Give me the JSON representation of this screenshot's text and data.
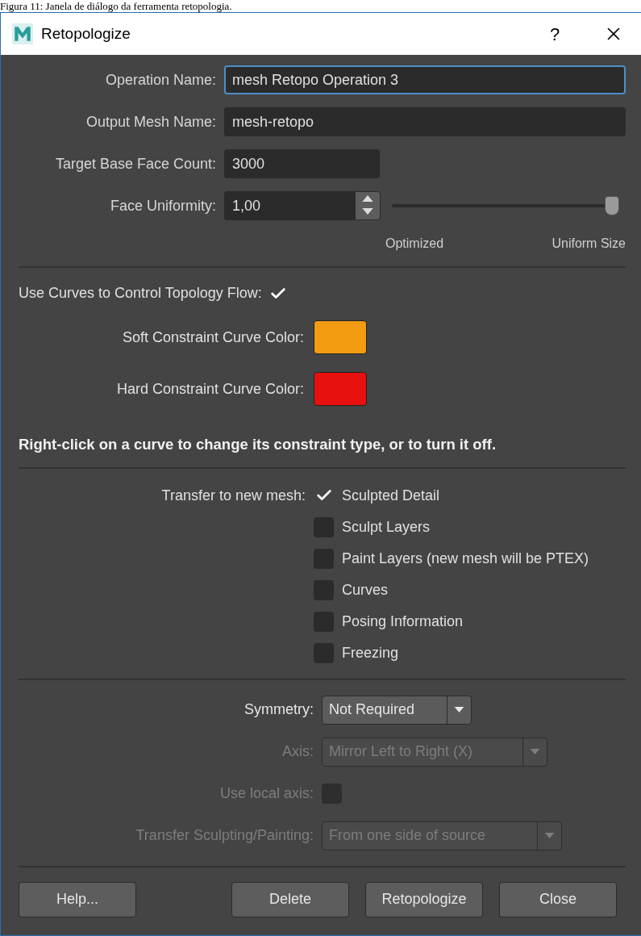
{
  "caption": "Figura 11: Janela de diálogo da ferramenta retopologia.",
  "window": {
    "title": "Retopologize",
    "help": "?"
  },
  "fields": [
    {
      "kind": "text",
      "label": "Operation Name:",
      "value": "mesh Retopo Operation 3",
      "focused": true
    },
    {
      "kind": "text",
      "label": "Output Mesh Name:",
      "value": "mesh-retopo",
      "focused": false
    },
    {
      "kind": "short",
      "label": "Target Base Face Count:",
      "value": "3000",
      "focused": false
    },
    {
      "kind": "spinner",
      "label": "Face Uniformity:",
      "value": "1,00",
      "focused": false,
      "level": 1.0,
      "min_label": "Optimized",
      "max_label": "Uniform Size"
    }
  ],
  "curves": {
    "label": "Use Curves to Control Topology Flow:",
    "checked": true
  },
  "curve_colors": [
    {
      "label": "Soft Constraint Curve Color:",
      "color": "#f39c12"
    },
    {
      "label": "Hard Constraint Curve Color:",
      "color": "#e8100f"
    }
  ],
  "note": "Right-click on a curve to change its constraint type, or to turn it off.",
  "transfer": {
    "label": "Transfer to new mesh:",
    "options": [
      {
        "label": "Sculpted Detail",
        "checked": true
      },
      {
        "label": "Sculpt Layers",
        "checked": false
      },
      {
        "label": "Paint Layers (new mesh will be PTEX)",
        "checked": false
      },
      {
        "label": "Curves",
        "checked": false
      },
      {
        "label": "Posing Information",
        "checked": false
      },
      {
        "label": "Freezing",
        "checked": false
      }
    ]
  },
  "symmetry_rows": [
    {
      "kind": "dropdown",
      "label": "Symmetry:",
      "value": "Not Required",
      "disabled": false
    },
    {
      "kind": "dropdown",
      "label": "Axis:",
      "value": "Mirror Left to Right (X)",
      "disabled": true
    },
    {
      "kind": "checkbox",
      "label": "Use local axis:",
      "checked": false,
      "disabled": true
    },
    {
      "kind": "dropdown",
      "label": "Transfer Sculpting/Painting:",
      "value": "From one side of source",
      "disabled": true
    }
  ],
  "buttons": [
    "Help...",
    "Delete",
    "Retopologize",
    "Close"
  ]
}
